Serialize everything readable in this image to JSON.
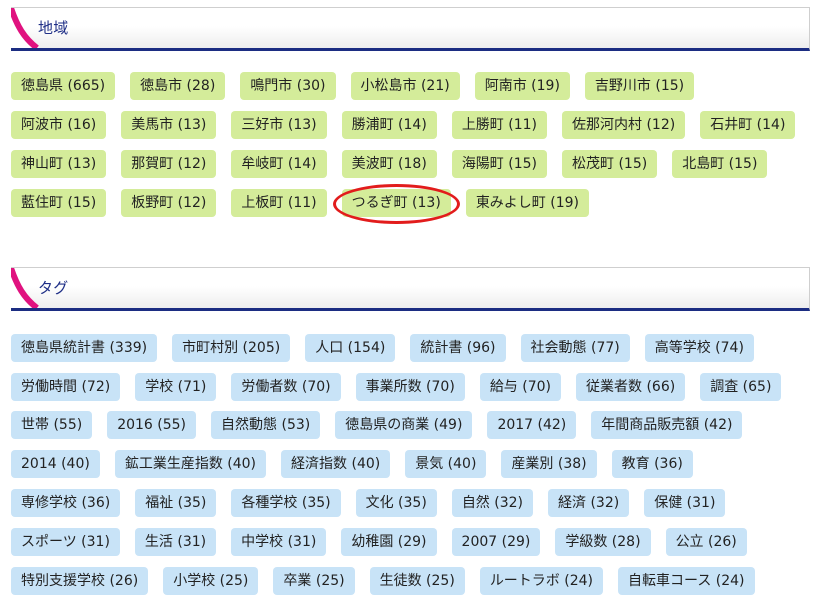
{
  "region": {
    "title": "地域",
    "rows": [
      [
        {
          "label": "徳島県 (665)"
        },
        {
          "label": "徳島市 (28)"
        },
        {
          "label": "鳴門市 (30)"
        },
        {
          "label": "小松島市 (21)"
        },
        {
          "label": "阿南市 (19)"
        },
        {
          "label": "吉野川市 (15)"
        }
      ],
      [
        {
          "label": "阿波市 (16)"
        },
        {
          "label": "美馬市 (13)"
        },
        {
          "label": "三好市 (13)"
        },
        {
          "label": "勝浦町 (14)"
        },
        {
          "label": "上勝町 (11)"
        },
        {
          "label": "佐那河内村 (12)"
        },
        {
          "label": "石井町 (14)"
        }
      ],
      [
        {
          "label": "神山町 (13)"
        },
        {
          "label": "那賀町 (12)"
        },
        {
          "label": "牟岐町 (14)"
        },
        {
          "label": "美波町 (18)"
        },
        {
          "label": "海陽町 (15)"
        },
        {
          "label": "松茂町 (15)"
        },
        {
          "label": "北島町 (15)"
        }
      ],
      [
        {
          "label": "藍住町 (15)"
        },
        {
          "label": "板野町 (12)"
        },
        {
          "label": "上板町 (11)"
        },
        {
          "label": "つるぎ町 (13)"
        },
        {
          "label": "東みよし町 (19)"
        }
      ]
    ]
  },
  "tags": {
    "title": "タグ",
    "rows": [
      [
        {
          "label": "徳島県統計書 (339)"
        },
        {
          "label": "市町村別 (205)"
        },
        {
          "label": "人口 (154)"
        },
        {
          "label": "統計書 (96)"
        },
        {
          "label": "社会動態 (77)"
        },
        {
          "label": "高等学校 (74)"
        }
      ],
      [
        {
          "label": "労働時間 (72)"
        },
        {
          "label": "学校 (71)"
        },
        {
          "label": "労働者数 (70)"
        },
        {
          "label": "事業所数 (70)"
        },
        {
          "label": "給与 (70)"
        },
        {
          "label": "従業者数 (66)"
        },
        {
          "label": "調査 (65)"
        }
      ],
      [
        {
          "label": "世帯 (55)"
        },
        {
          "label": "2016 (55)"
        },
        {
          "label": "自然動態 (53)"
        },
        {
          "label": "徳島県の商業 (49)"
        },
        {
          "label": "2017 (42)"
        },
        {
          "label": "年間商品販売額 (42)"
        }
      ],
      [
        {
          "label": "2014 (40)"
        },
        {
          "label": "鉱工業生産指数 (40)"
        },
        {
          "label": "経済指数 (40)"
        },
        {
          "label": "景気 (40)"
        },
        {
          "label": "産業別 (38)"
        },
        {
          "label": "教育 (36)"
        }
      ],
      [
        {
          "label": "専修学校 (36)"
        },
        {
          "label": "福祉 (35)"
        },
        {
          "label": "各種学校 (35)"
        },
        {
          "label": "文化 (35)"
        },
        {
          "label": "自然 (32)"
        },
        {
          "label": "経済 (32)"
        },
        {
          "label": "保健 (31)"
        }
      ],
      [
        {
          "label": "スポーツ (31)"
        },
        {
          "label": "生活 (31)"
        },
        {
          "label": "中学校 (31)"
        },
        {
          "label": "幼稚園 (29)"
        },
        {
          "label": "2007 (29)"
        },
        {
          "label": "学級数 (28)"
        },
        {
          "label": "公立 (26)"
        }
      ],
      [
        {
          "label": "特別支援学校 (26)"
        },
        {
          "label": "小学校 (25)"
        },
        {
          "label": "卒業 (25)"
        },
        {
          "label": "生徒数 (25)"
        },
        {
          "label": "ルートラボ (24)"
        },
        {
          "label": "自転車コース (24)"
        }
      ]
    ]
  },
  "colors": {
    "region_chip": "#d4ec9a",
    "tag_chip": "#c8e3f7",
    "header_accent": "#e0127f",
    "header_underline": "#1c2d82",
    "header_title": "#1e2e86",
    "highlight_ring": "#e21c1c"
  }
}
